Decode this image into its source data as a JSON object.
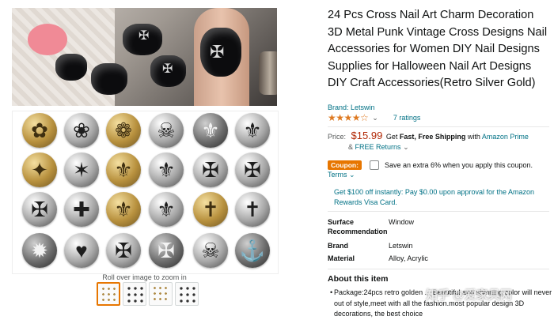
{
  "product": {
    "title": "24 Pcs Cross Nail Art Charm Decoration 3D Metal Punk Vintage Cross Designs Nail Accessories for Women DIY Nail Designs Supplies for Halloween Nail Art Designs DIY Craft Accessories(Retro Silver Gold)",
    "brand_link": "Brand: Letswin",
    "rating_value": 4,
    "rating_count": "7 ratings"
  },
  "price": {
    "label": "Price:",
    "amount": "$15.99",
    "get_fast_prefix": "Get",
    "fast_free": "Fast, Free Shipping",
    "with_text": "with",
    "prime": "Amazon Prime",
    "returns_prefix": "&",
    "free_returns": "FREE Returns",
    "returns_chevron": "⌄"
  },
  "coupon": {
    "badge": "Coupon:",
    "text": "Save an extra 6% when you apply this coupon.",
    "terms": "Terms",
    "terms_chevron": "⌄"
  },
  "promo": "Get $100 off instantly: Pay $0.00 upon approval for the Amazon Rewards Visa Card.",
  "specs": [
    {
      "key": "Surface Recommendation",
      "value": "Window"
    },
    {
      "key": "Brand",
      "value": "Letswin"
    },
    {
      "key": "Material",
      "value": "Alloy, Acrylic"
    }
  ],
  "about": {
    "heading": "About this item",
    "bullet": "•",
    "text": "Package:24pcs retro golden ... Beautiful and shinning color will never out of style,meet with all the fashion.most popular design 3D decorations, the best choice"
  },
  "gallery": {
    "zoom_hint": "Roll over image to zoom in",
    "thumbnail_count": 4
  },
  "watermark": "知乎 @爱家具网",
  "colors": {
    "price": "#B12704",
    "link": "#007185",
    "stars": "#DE7921",
    "coupon_badge": "#E77600"
  }
}
